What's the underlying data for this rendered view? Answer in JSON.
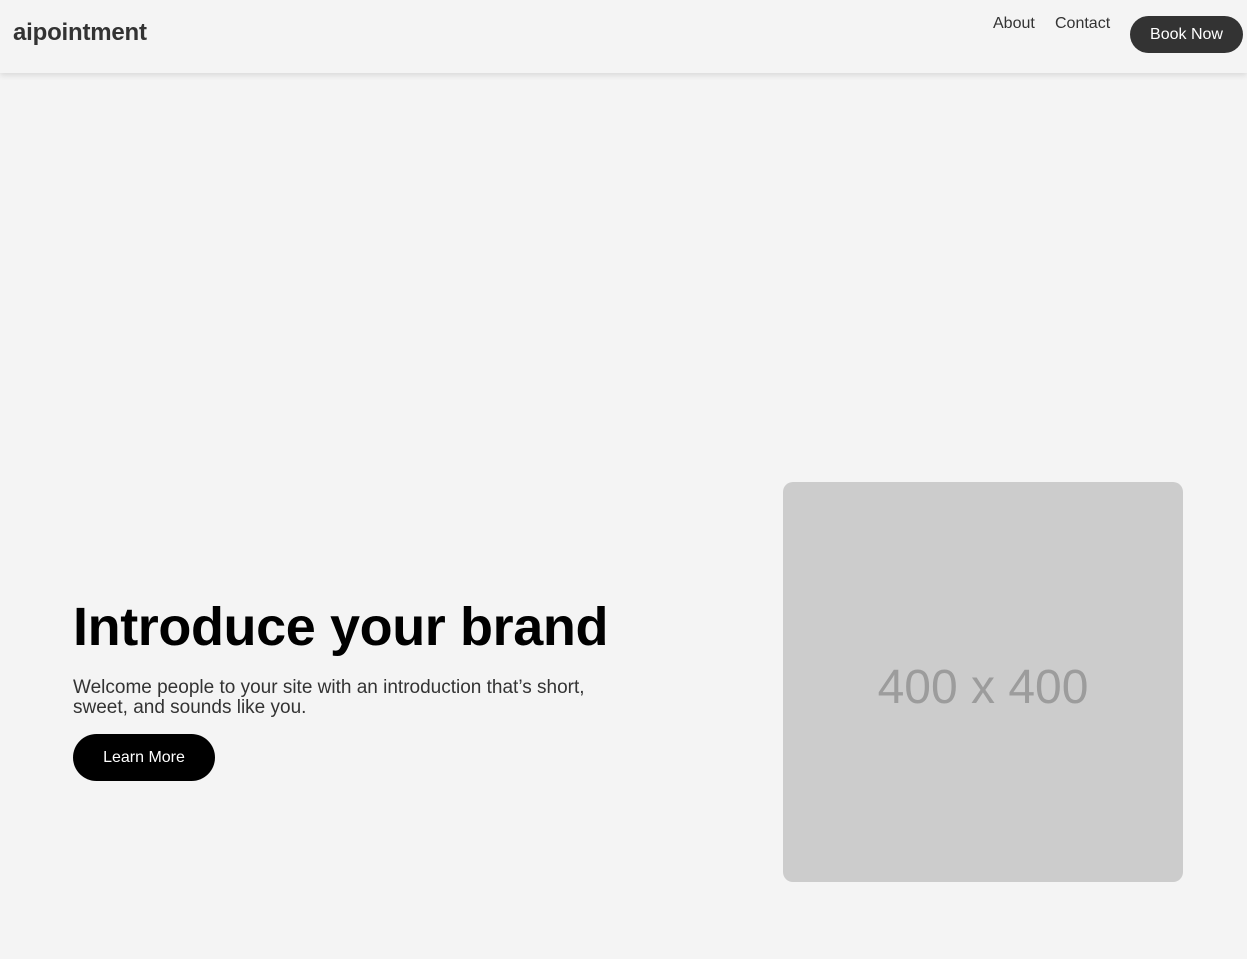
{
  "header": {
    "brand": "aipointment",
    "nav": {
      "about": "About",
      "contact": "Contact"
    },
    "cta": "Book Now"
  },
  "hero": {
    "title": "Introduce your brand",
    "subtitle": "Welcome people to your site with an introduction that’s short, sweet, and sounds like you.",
    "button": "Learn More",
    "image_placeholder": "400 x 400"
  },
  "colors": {
    "background": "#f4f4f4",
    "primary_button": "#333333",
    "hero_button": "#000000",
    "placeholder": "#cccccc"
  }
}
